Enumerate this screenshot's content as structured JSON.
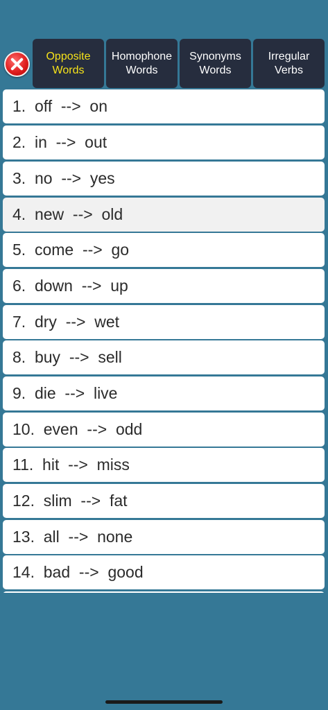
{
  "tabs": [
    {
      "line1": "Opposite",
      "line2": "Words",
      "active": true
    },
    {
      "line1": "Homophone",
      "line2": "Words",
      "active": false
    },
    {
      "line1": "Synonyms",
      "line2": "Words",
      "active": false
    },
    {
      "line1": "Irregular",
      "line2": "Verbs",
      "active": false
    }
  ],
  "close_icon": "close-x-icon",
  "colors": {
    "background": "#357896",
    "tab": "#262d3e",
    "active_tab_text": "#f6e21a"
  },
  "items": [
    "1.  off  -->  on",
    "2.  in  -->  out",
    "3.  no  -->  yes",
    "4.  new  -->  old",
    "5.  come  -->  go",
    "6.  down  -->  up",
    "7.  dry  -->  wet",
    "8.  buy  -->  sell",
    "9.  die  -->  live",
    "10.  even  -->  odd",
    "11.  hit  -->  miss",
    "12.  slim  -->  fat",
    "13.  all  -->  none",
    "14.  bad  -->  good",
    ""
  ]
}
